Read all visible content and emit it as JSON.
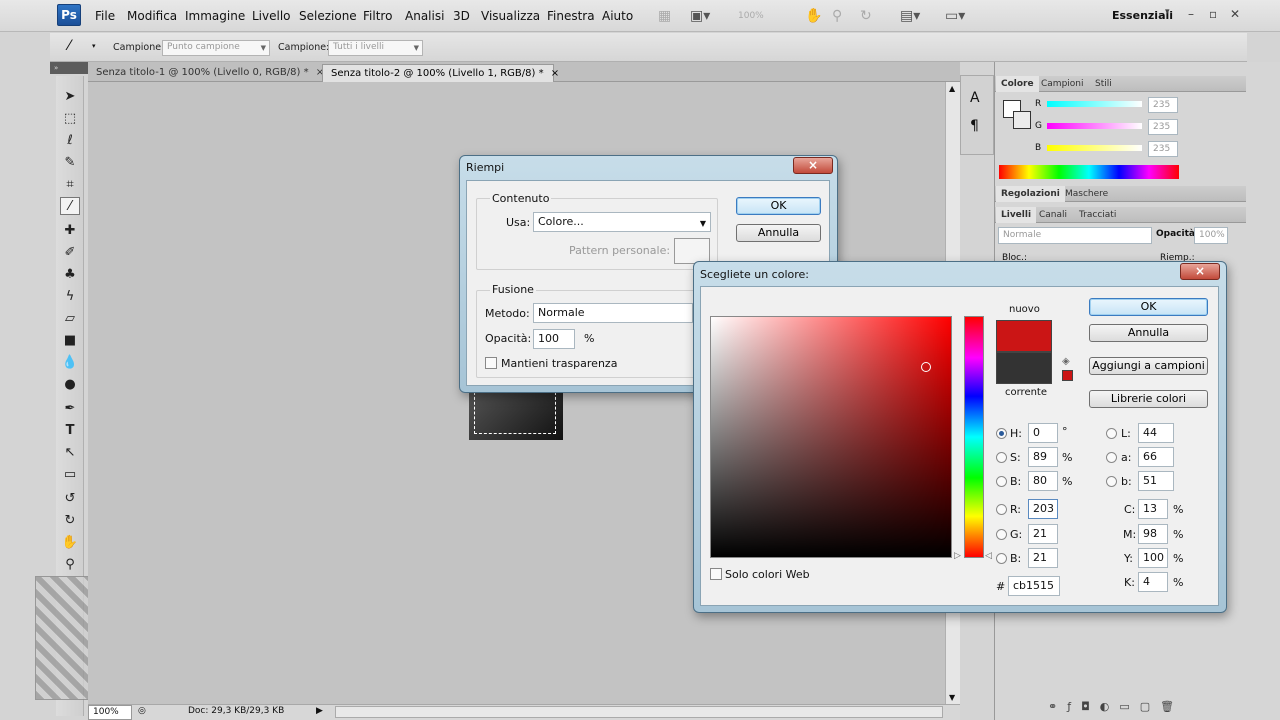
{
  "menubar": {
    "logo": "Ps",
    "items": [
      "File",
      "Modifica",
      "Immagine",
      "Livello",
      "Selezione",
      "Filtro",
      "Analisi",
      "3D",
      "Visualizza",
      "Finestra",
      "Aiuto"
    ],
    "zoom_value": "100%",
    "workspace": "Essenziali"
  },
  "options_bar": {
    "campione_label": "Campione:",
    "campione_value": "Punto campione",
    "campione2_label": "Campione:",
    "campione2_value": "Tutti i livelli"
  },
  "doc_tabs": [
    {
      "label": "Senza titolo-1 @ 100% (Livello 0, RGB/8) *",
      "close": "×"
    },
    {
      "label": "Senza titolo-2 @ 100% (Livello 1, RGB/8) *",
      "close": "×"
    }
  ],
  "status_bar": {
    "zoom": "100%",
    "doc_info": "Doc: 29,3 KB/29,3 KB"
  },
  "color_panel": {
    "tabs": [
      "Colore",
      "Campioni",
      "Stili"
    ],
    "channels": [
      {
        "label": "R",
        "value": "235"
      },
      {
        "label": "G",
        "value": "235"
      },
      {
        "label": "B",
        "value": "235"
      }
    ]
  },
  "adjust_panel": {
    "tabs": [
      "Regolazioni",
      "Maschere"
    ]
  },
  "layers_panel": {
    "tabs": [
      "Livelli",
      "Canali",
      "Tracciati"
    ],
    "blend_mode": "Normale",
    "opacity_label": "Opacità:",
    "opacity_value": "100%",
    "lock_label": "Bloc.:",
    "fill_label": "Riemp.:"
  },
  "fill_dialog": {
    "title": "Riempi",
    "close": "×",
    "content_group": "Contenuto",
    "use_label": "Usa:",
    "use_value": "Colore...",
    "pattern_label": "Pattern personale:",
    "blend_group": "Fusione",
    "mode_label": "Metodo:",
    "mode_value": "Normale",
    "opacity_label": "Opacità:",
    "opacity_value": "100",
    "opacity_unit": "%",
    "preserve_label": "Mantieni trasparenza",
    "ok": "OK",
    "cancel": "Annulla"
  },
  "picker_dialog": {
    "title": "Scegliete un colore:",
    "close": "×",
    "new_label": "nuovo",
    "current_label": "corrente",
    "new_color": "#cb1515",
    "current_color": "#333333",
    "ok": "OK",
    "cancel": "Annulla",
    "add_swatch": "Aggiungi a campioni",
    "libraries": "Librerie colori",
    "web_only": "Solo colori Web",
    "hsb": [
      {
        "label": "H:",
        "value": "0",
        "unit": "°"
      },
      {
        "label": "S:",
        "value": "89",
        "unit": "%"
      },
      {
        "label": "B:",
        "value": "80",
        "unit": "%"
      }
    ],
    "rgb": [
      {
        "label": "R:",
        "value": "203"
      },
      {
        "label": "G:",
        "value": "21"
      },
      {
        "label": "B:",
        "value": "21"
      }
    ],
    "lab": [
      {
        "label": "L:",
        "value": "44"
      },
      {
        "label": "a:",
        "value": "66"
      },
      {
        "label": "b:",
        "value": "51"
      }
    ],
    "cmyk": [
      {
        "label": "C:",
        "value": "13",
        "unit": "%"
      },
      {
        "label": "M:",
        "value": "98",
        "unit": "%"
      },
      {
        "label": "Y:",
        "value": "100",
        "unit": "%"
      },
      {
        "label": "K:",
        "value": "4",
        "unit": "%"
      }
    ],
    "hex_label": "#",
    "hex_value": "cb1515"
  }
}
